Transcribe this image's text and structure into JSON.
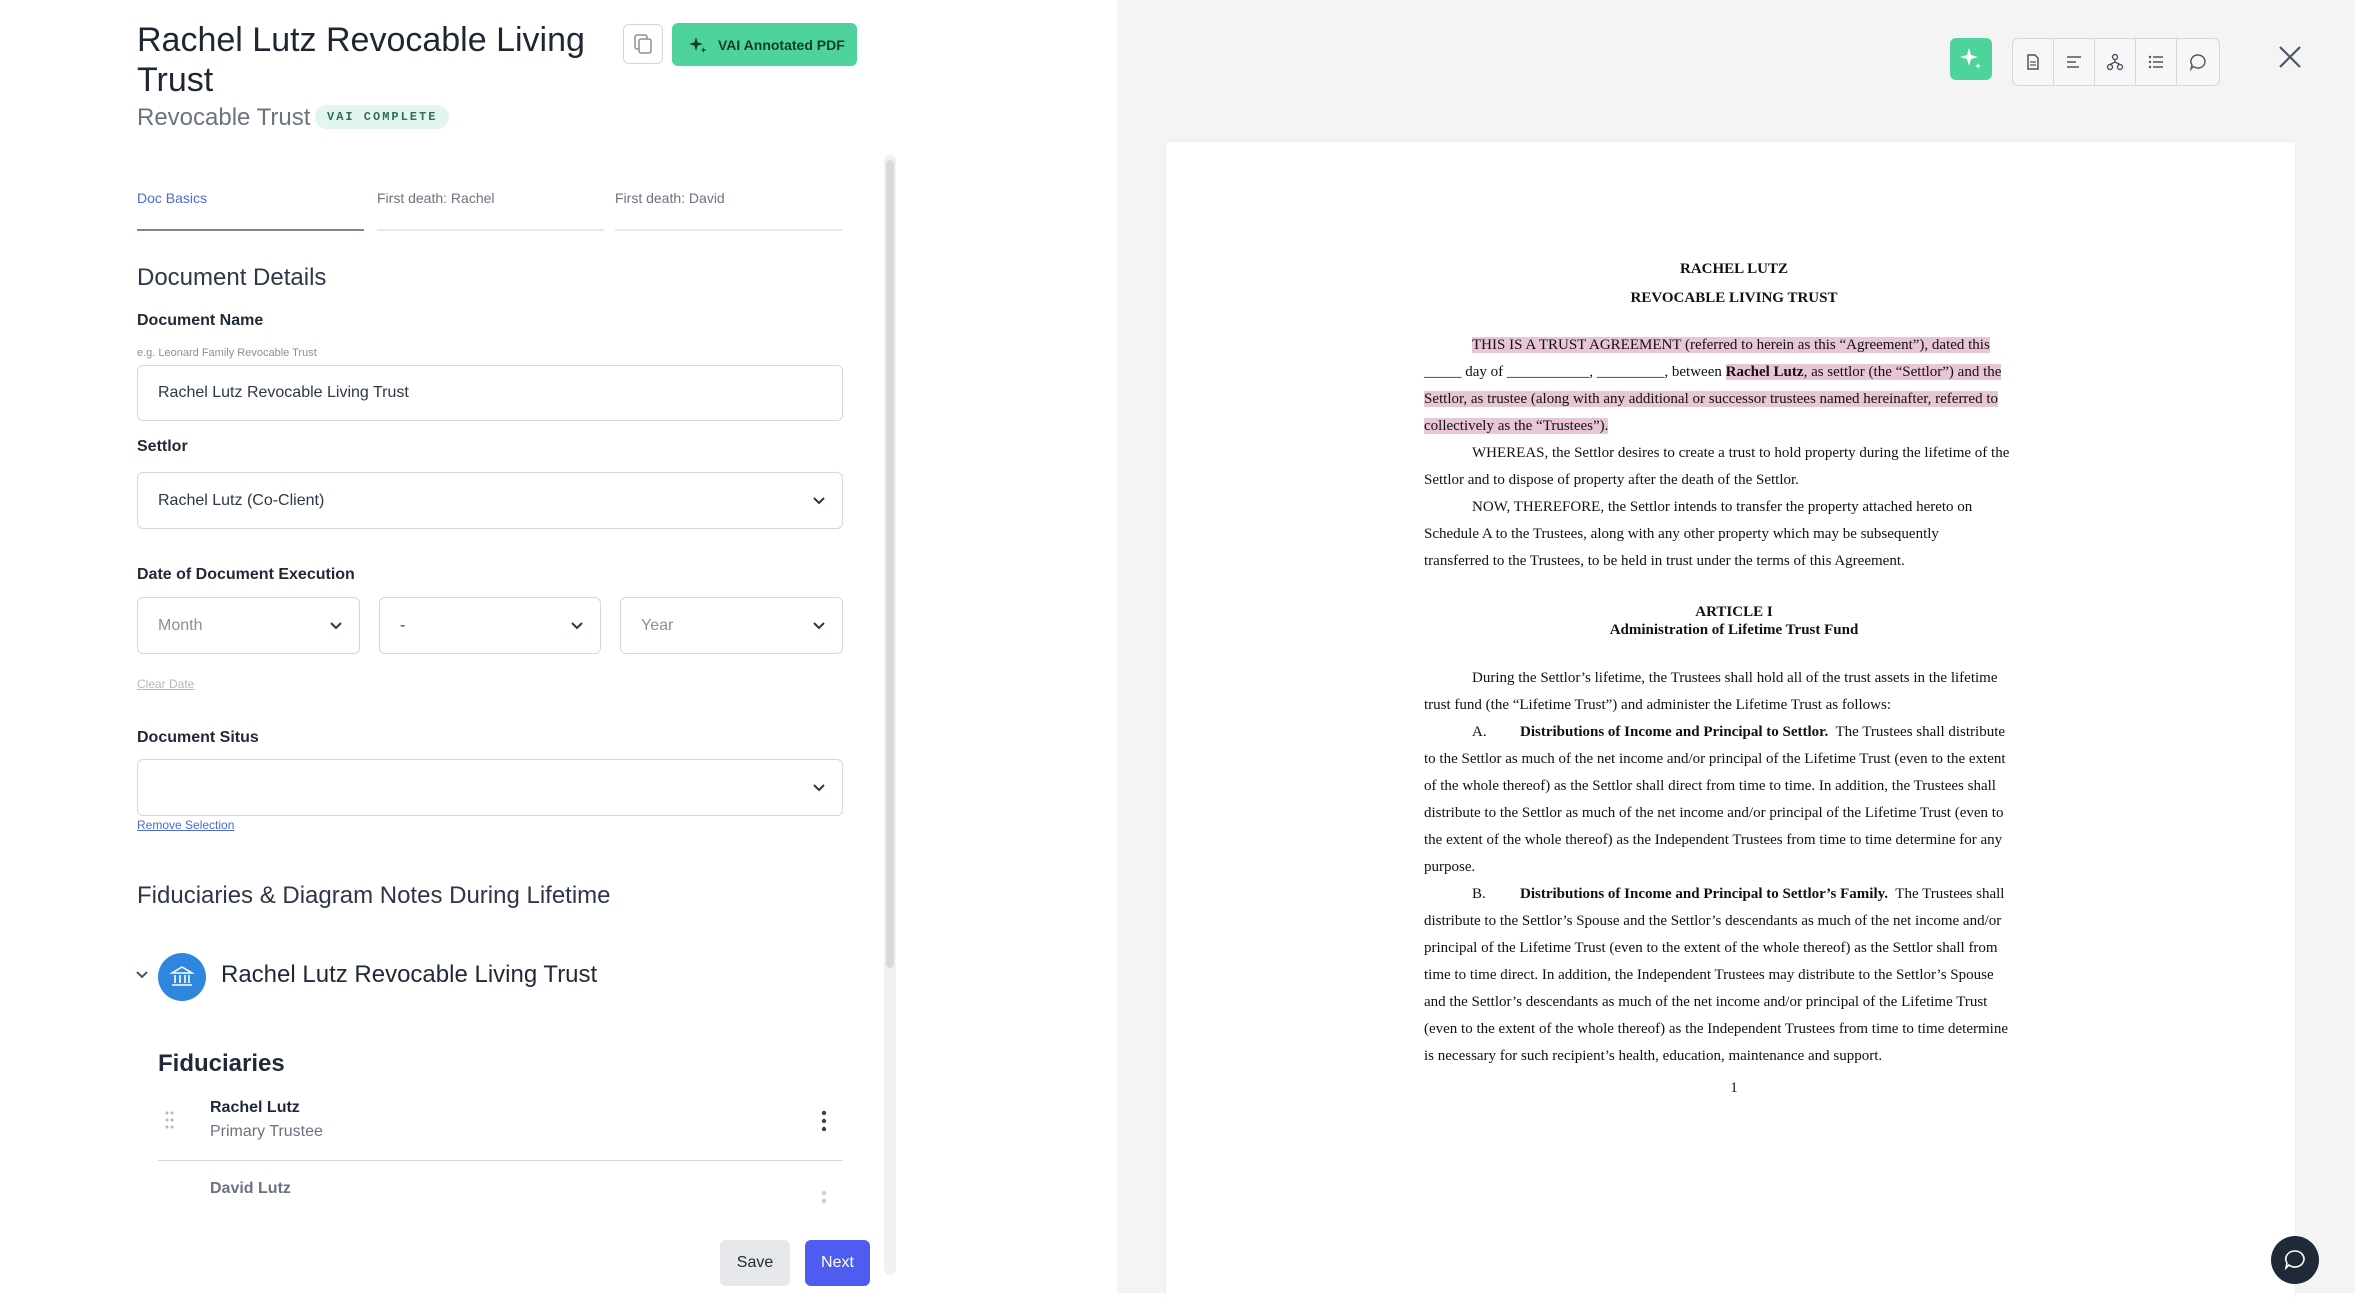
{
  "header": {
    "title": "Rachel Lutz Revocable Living Trust",
    "subtitle": "Revocable Trust",
    "badge": "VAI COMPLETE",
    "vai_button": "VAI Annotated PDF"
  },
  "tabs": [
    "Doc Basics",
    "First death: Rachel",
    "First death: David"
  ],
  "document_details": {
    "heading": "Document Details",
    "name_label": "Document Name",
    "name_help": "e.g. Leonard Family Revocable Trust",
    "name_value": "Rachel Lutz Revocable Living Trust",
    "settlor_label": "Settlor",
    "settlor_value": "Rachel Lutz (Co-Client)",
    "date_label": "Date of Document Execution",
    "month": "Month",
    "day": "-",
    "year": "Year",
    "clear_date": "Clear Date",
    "situs_label": "Document Situs",
    "situs_value": "",
    "remove_selection": "Remove Selection"
  },
  "fiduciaries_section": {
    "heading": "Fiduciaries & Diagram Notes During Lifetime",
    "trust_name": "Rachel Lutz Revocable Living Trust",
    "fiduciaries_title": "Fiduciaries",
    "items": [
      {
        "name": "Rachel Lutz",
        "role": "Primary Trustee"
      },
      {
        "name": "David Lutz",
        "role": ""
      }
    ]
  },
  "footer": {
    "save": "Save",
    "next": "Next"
  },
  "colors": {
    "accent_green": "#4dd39b",
    "primary_blue": "#4f5cf0",
    "highlight": "#e9c6d6",
    "link_blue": "#4b6bd6"
  },
  "icons": [
    "copy-icon",
    "sparkle-icon",
    "document-icon",
    "align-left-icon",
    "hierarchy-icon",
    "list-icon",
    "comment-icon",
    "close-icon",
    "chevron-down-icon",
    "bank-icon",
    "drag-handle-icon",
    "kebab-menu-icon",
    "chat-icon"
  ],
  "document": {
    "title1": "RACHEL LUTZ",
    "title2": "REVOCABLE LIVING TRUST",
    "p1": [
      "THIS IS A TRUST AGREEMENT (referred to herein as this “Agreement”), dated this",
      "_____ day of ___________, _________, between ",
      "Rachel Lutz",
      ", as settlor (the “Settlor”) and the",
      "Settlor, as trustee (along with any additional or successor trustees named hereinafter, referred to",
      "collectively as the “Trustees”)."
    ],
    "p2": [
      "WHEREAS, the Settlor desires to create a trust to hold property during the lifetime of the",
      "Settlor and to dispose of property after the death of the Settlor."
    ],
    "p3": [
      "NOW, THEREFORE, the Settlor intends to transfer the property attached hereto on",
      "Schedule A to the Trustees, along with any other property which may be subsequently",
      "transferred to the Trustees, to be held in trust under the terms of this Agreement."
    ],
    "article": "ARTICLE I",
    "article_title": "Administration of Lifetime Trust Fund",
    "p4": [
      "During the Settlor’s lifetime, the Trustees shall hold all of the trust assets in the lifetime",
      "trust fund (the “Lifetime Trust”) and administer the Lifetime Trust as follows:"
    ],
    "pA_marker": "A.",
    "pA_heading": "Distributions of Income and Principal to Settlor.",
    "pA": [
      "The Trustees shall distribute",
      "to the Settlor as much of the net income and/or principal of the Lifetime Trust (even to the extent",
      "of the whole thereof) as the Settlor shall direct from time to time. In addition, the Trustees shall",
      "distribute to the Settlor as much of the net income and/or principal of the Lifetime Trust (even to",
      "the extent of the whole thereof) as the Independent Trustees from time to time determine for any",
      "purpose."
    ],
    "pB_marker": "B.",
    "pB_heading": "Distributions of Income and Principal to Settlor’s Family.",
    "pB": [
      "The Trustees shall",
      "distribute to the Settlor’s Spouse and the Settlor’s descendants as much of the net income and/or",
      "principal of the Lifetime Trust (even to the extent of the whole thereof) as the Settlor shall from",
      "time to time direct. In addition, the Independent Trustees may distribute to the Settlor’s Spouse",
      "and the Settlor’s descendants as much of the net income and/or principal of the Lifetime Trust",
      "(even to the extent of the whole thereof) as the Independent Trustees from time to time determine",
      "is necessary for such recipient’s health, education, maintenance and support."
    ],
    "page_number": "1"
  }
}
